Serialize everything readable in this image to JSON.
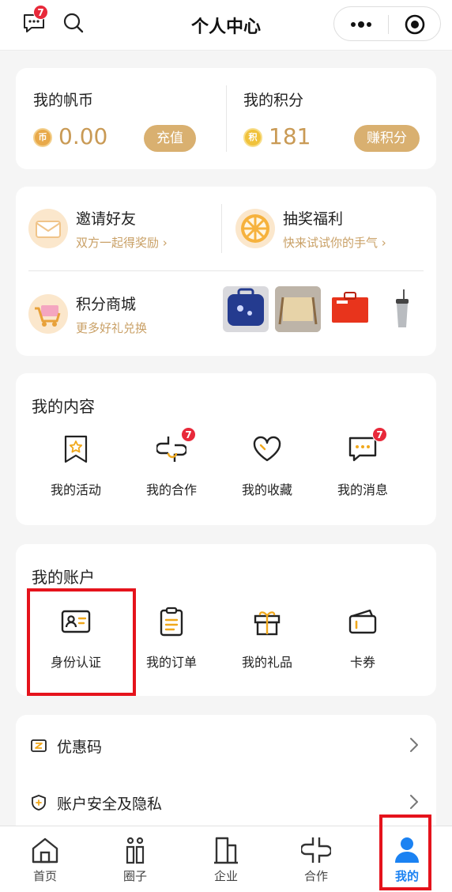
{
  "header": {
    "title": "个人中心",
    "message_badge": "7"
  },
  "coins": {
    "fanbi_label": "我的帆币",
    "fanbi_icon_text": "币",
    "fanbi_value": "0.00",
    "recharge_label": "充值",
    "points_label": "我的积分",
    "points_icon_text": "积",
    "points_value": "181",
    "earn_label": "赚积分"
  },
  "features": {
    "invite_title": "邀请好友",
    "invite_sub": "双方一起得奖励 ›",
    "lottery_title": "抽奖福利",
    "lottery_sub": "快来试试你的手气 ›",
    "mall_title": "积分商城",
    "mall_sub": "更多好礼兑换"
  },
  "content": {
    "title": "我的内容",
    "items": [
      {
        "label": "我的活动",
        "icon": "star-bookmark-icon",
        "badge": ""
      },
      {
        "label": "我的合作",
        "icon": "cooperation-icon",
        "badge": "7"
      },
      {
        "label": "我的收藏",
        "icon": "heart-icon",
        "badge": ""
      },
      {
        "label": "我的消息",
        "icon": "message-icon",
        "badge": "7"
      }
    ]
  },
  "account": {
    "title": "我的账户",
    "items": [
      {
        "label": "身份认证",
        "icon": "id-card-icon"
      },
      {
        "label": "我的订单",
        "icon": "clipboard-icon"
      },
      {
        "label": "我的礼品",
        "icon": "gift-icon"
      },
      {
        "label": "卡券",
        "icon": "wallet-icon"
      }
    ]
  },
  "list": {
    "coupon_code": "优惠码",
    "security": "账户安全及隐私"
  },
  "tabs": [
    {
      "label": "首页",
      "icon": "home-icon"
    },
    {
      "label": "圈子",
      "icon": "circle-people-icon"
    },
    {
      "label": "企业",
      "icon": "building-icon"
    },
    {
      "label": "合作",
      "icon": "cooperation-icon"
    },
    {
      "label": "我的",
      "icon": "person-icon",
      "active": true
    }
  ],
  "colors": {
    "accent_gold": "#d9b070",
    "active_tab": "#1b82f2",
    "badge_red": "#e8293a",
    "highlight_red": "#e5131c"
  }
}
